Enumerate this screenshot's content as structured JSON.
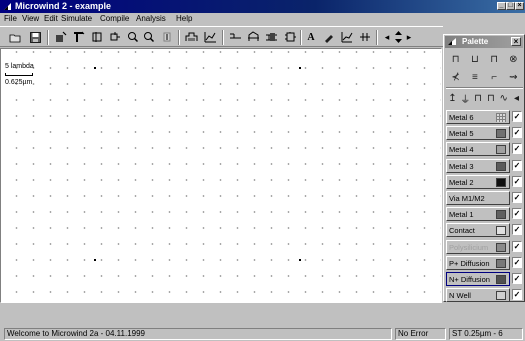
{
  "window": {
    "title": "Microwind 2 - example",
    "icon": "microwind-app-icon"
  },
  "menu": [
    "File",
    "View",
    "Edit",
    "Simulate",
    "Compile",
    "Analysis",
    "Help"
  ],
  "toolbar": {
    "icons": [
      "open-icon",
      "save-icon",
      "add-box-icon",
      "add-line-icon",
      "cut-icon",
      "stretch-icon",
      "zoom-in-icon",
      "zoom-out-icon",
      "grid-icon",
      "cross-section-icon",
      "process-3d-icon",
      "connect-icon",
      "mos-generator-icon",
      "layout-view-icon",
      "text-icon",
      "pen-icon",
      "chart-icon",
      "module-icon",
      "scroll-left-icon",
      "scroll-right-icon"
    ]
  },
  "canvas": {
    "scale_lambda": "5 lambda",
    "scale_um": "0.625µm"
  },
  "palette": {
    "title": "Palette",
    "close": "×",
    "row1_icons": [
      "nmos-icon",
      "pmos-icon",
      "capacitor-icon",
      "ground-icon"
    ],
    "row2_icons": [
      "contact-poly-icon",
      "bus-icon",
      "via-icon",
      "resistor-icon"
    ],
    "row3_icons": [
      "vdd-icon",
      "vss-icon",
      "clock-icon",
      "pulse-icon",
      "sine-icon",
      "arrow-left-icon"
    ],
    "layers": [
      {
        "name": "Metal 6",
        "color": "#d8d8d8",
        "checked": true,
        "pattern": "grid"
      },
      {
        "name": "Metal 5",
        "color": "#707070",
        "checked": true
      },
      {
        "name": "Metal 4",
        "color": "#a0a0a0",
        "checked": true
      },
      {
        "name": "Metal 3",
        "color": "#5a5a5a",
        "checked": true
      },
      {
        "name": "Metal 2",
        "color": "#101010",
        "checked": true
      },
      {
        "name": "Via M1/M2",
        "color": "#f0f0f0",
        "checked": true,
        "pattern": "dots"
      },
      {
        "name": "Metal 1",
        "color": "#606060",
        "checked": true
      },
      {
        "name": "Contact",
        "color": "#e0e0e0",
        "checked": true
      },
      {
        "name": "Polysilicium",
        "color": "#8a8a8a",
        "checked": true,
        "label_color": "#a0a0a0"
      },
      {
        "name": "P+ Diffusion",
        "color": "#787878",
        "checked": true
      },
      {
        "name": "N+ Diffusion",
        "color": "#505050",
        "checked": true,
        "selected": true
      },
      {
        "name": "N Well",
        "color": "#d0d0d0",
        "checked": true
      }
    ],
    "check_mark": "✓"
  },
  "status": {
    "message": "Welcome to Microwind 2a - 04.11.1999",
    "error": "No Error",
    "technology": "ST 0.25µm - 6"
  }
}
